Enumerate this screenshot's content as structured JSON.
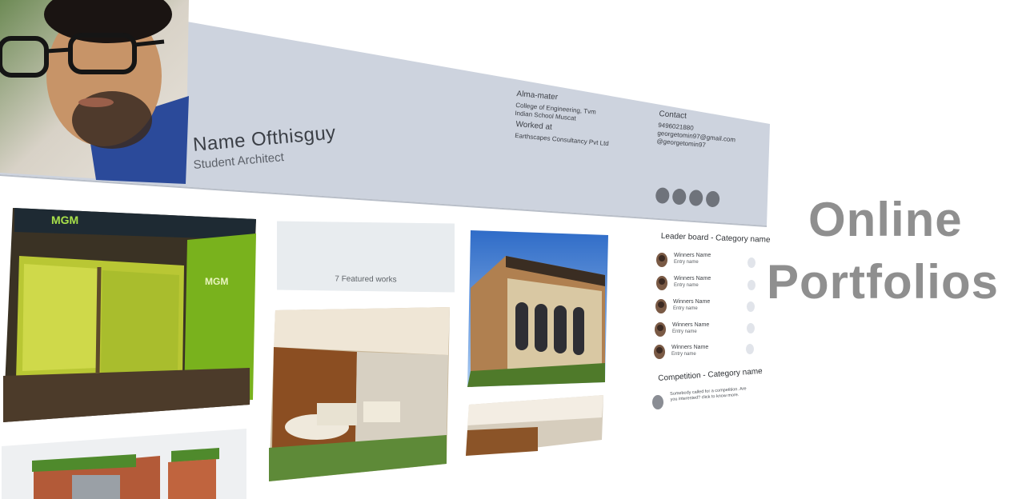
{
  "profile": {
    "name": "Name Ofthisguy",
    "title": "Student Architect",
    "alma_mater_heading": "Alma-mater",
    "alma_mater_lines": [
      "College of Engineering, Tvm",
      "Indian School Muscat"
    ],
    "worked_heading": "Worked at",
    "worked_lines": [
      "Earthscapes Consultancy Pvt Ltd"
    ],
    "contact_heading": "Contact",
    "contact_lines": [
      "9496021880",
      "georgetomin97@gmail.com",
      "@georgetomin97"
    ],
    "social_icons": [
      "social-icon-1",
      "social-icon-2",
      "social-icon-3",
      "social-icon-4"
    ]
  },
  "featured": {
    "label": "7 Featured works"
  },
  "leaderboard": {
    "title": "Leader board - Category name",
    "entries": [
      {
        "name": "Winners Name",
        "entry": "Entry name"
      },
      {
        "name": "Winners Name",
        "entry": "Entry name"
      },
      {
        "name": "Winners Name",
        "entry": "Entry name"
      },
      {
        "name": "Winners Name",
        "entry": "Entry name"
      },
      {
        "name": "Winners Name",
        "entry": "Entry name"
      }
    ]
  },
  "competition": {
    "title": "Competition - Category name",
    "text": "Somebody called for a competition. Are you interested? click to know more."
  },
  "heading": {
    "line1": "Online",
    "line2": "Portfolios"
  },
  "colors": {
    "hero_band": "#cdd3de",
    "heading_gray": "#8f8f8f",
    "accent_green": "#9fd43a"
  }
}
